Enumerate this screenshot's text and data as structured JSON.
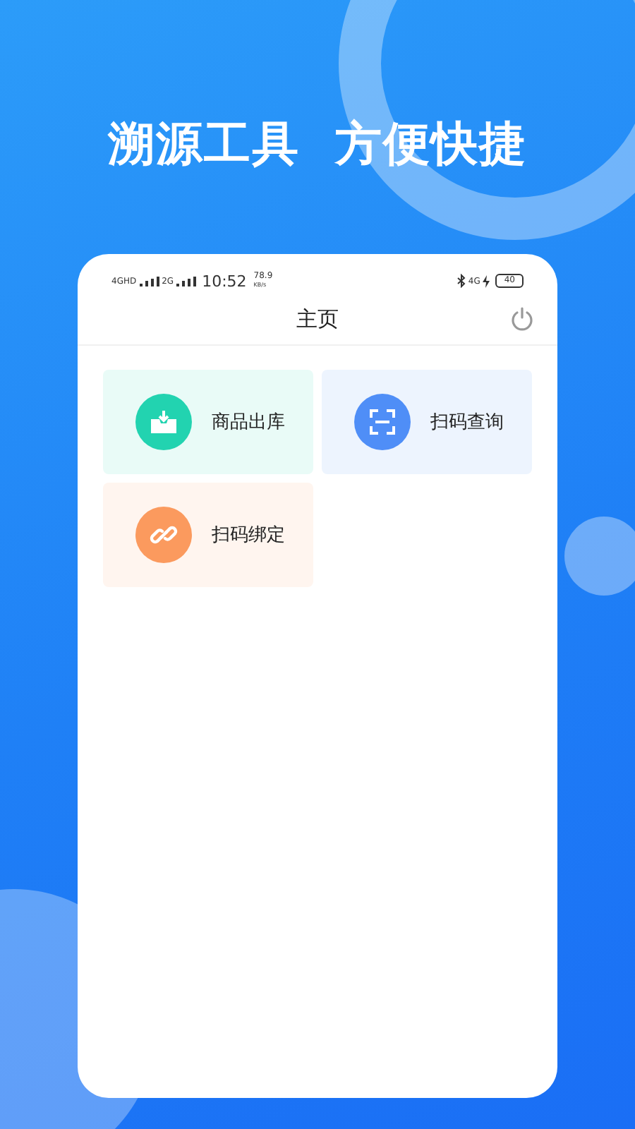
{
  "headline": "溯源工具  方便快捷",
  "status_bar": {
    "network_1": "4GHD",
    "network_2": "2G",
    "time": "10:52",
    "speed": "78.9",
    "speed_unit": "KB/s",
    "network_3": "4G",
    "battery": "40"
  },
  "header": {
    "title": "主页"
  },
  "tiles": [
    {
      "label": "商品出库",
      "kind": "box",
      "color": "#22d3b0"
    },
    {
      "label": "扫码查询",
      "kind": "scan",
      "color": "#4f8ef7"
    },
    {
      "label": "扫码绑定",
      "kind": "link",
      "color": "#fb9a5e"
    }
  ]
}
